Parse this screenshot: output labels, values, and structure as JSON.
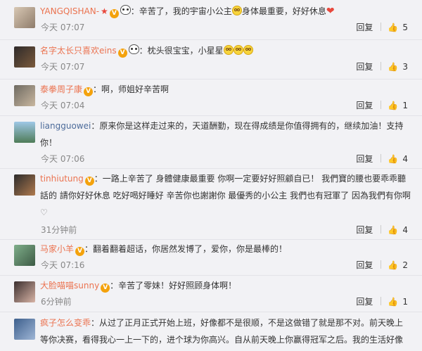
{
  "labels": {
    "reply": "回复"
  },
  "emoji": {
    "smile": "smile-face",
    "heart": "red-heart",
    "heart_outline": "outline-heart"
  },
  "comments": [
    {
      "user": "YANGQISHAN-",
      "segments": [
        "：辛苦了，我的宇宙小公主",
        "身体最重要，好好休息"
      ],
      "time": "今天 07:07",
      "likes": "5"
    },
    {
      "user": "名字太长只喜欢eins",
      "segments": [
        "：枕头很宝宝，小星星"
      ],
      "time": "今天 07:07",
      "likes": "3"
    },
    {
      "user": "泰拳周子康",
      "segments": [
        "：啊，师姐好辛苦啊"
      ],
      "time": "今天 07:04",
      "likes": "1"
    },
    {
      "user": "liangguowei",
      "segments": [
        "：原来你是这样走过来的，天道酬勤，现在得成绩是你值得拥有的，继续加油！支持你！"
      ],
      "time": "今天 07:06",
      "likes": "4"
    },
    {
      "user": "tinhiutung",
      "segments": [
        "：一路上辛苦了 身體健康最重要 你啊一定要好好照顧自已！ 我們寶的腰也要乖乖聽話的 請你好好休息 吃好喝好睡好 辛苦你也謝謝你 最優秀的小公主 我們也有冠軍了 因為我們有你啊"
      ],
      "time": "31分钟前",
      "likes": "4"
    },
    {
      "user": "马家小羊",
      "segments": [
        "：翻着翻着超话，你居然发博了，爱你，你是最棒的！"
      ],
      "time": "今天 07:16",
      "likes": "2"
    },
    {
      "user": "大脸喵喵sunny",
      "segments": [
        "：辛苦了零妹！好好照顾身体啊！"
      ],
      "time": "6分钟前",
      "likes": "1"
    },
    {
      "user": "疯子怎么变乖",
      "segments": [
        "：从过了正月正式开始上班，好像都不是很顺，不是这做错了就是那不对。前天晚上等你决赛，看得我心一上一下的，进个球为你高兴。自从前天晚上你赢得冠军之后。我的生活好像"
      ]
    }
  ]
}
